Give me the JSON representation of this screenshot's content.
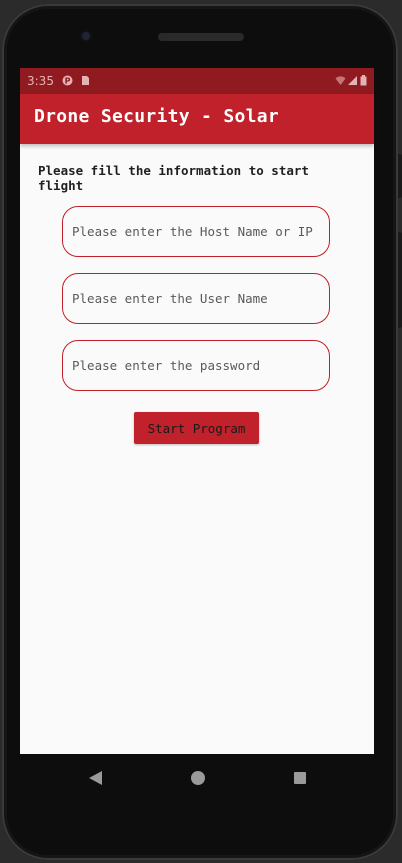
{
  "status_bar": {
    "time": "3:35",
    "icons": [
      "notification-p-icon",
      "sim-card-icon",
      "wifi-icon",
      "signal-icon",
      "battery-icon"
    ]
  },
  "app_bar": {
    "title": "Drone Security - Solar",
    "color": "#c0212a"
  },
  "form": {
    "instructions": "Please fill the information to start flight",
    "host_field": {
      "value": "",
      "placeholder": "Please enter the Host Name or IP"
    },
    "username_field": {
      "value": "",
      "placeholder": "Please enter the User Name"
    },
    "password_field": {
      "value": "",
      "placeholder": "Please enter the password"
    },
    "start_button_label": "Start Program"
  },
  "nav_bar": {
    "buttons": [
      "back-icon",
      "home-icon",
      "recents-icon"
    ]
  },
  "colors": {
    "accent": "#c0212a",
    "status_bar": "#8f1b20",
    "background": "#fafafa"
  }
}
